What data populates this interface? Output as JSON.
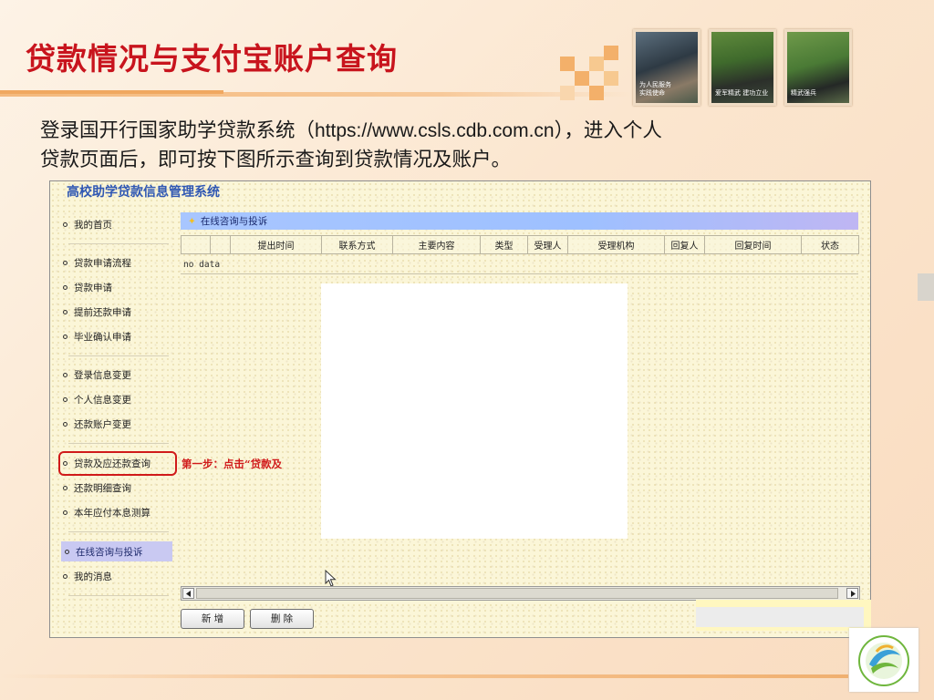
{
  "slide": {
    "title": "贷款情况与支付宝账户查询",
    "body_line1_before": "登录国开行国家助学贷款系统（",
    "body_url": "https://www.csls.cdb.com.cn",
    "body_line1_after": "），进入个人",
    "body_line2": "贷款页面后，即可按下图所示查询到贷款情况及账户。",
    "photo_captions": [
      "为人民服务\n实践使命",
      "爱军精武  建功立业",
      "精武强兵"
    ]
  },
  "screenshot": {
    "system_title": "高校助学贷款信息管理系统",
    "menu": [
      {
        "label": "我的首页"
      },
      {
        "label": "贷款申请流程"
      },
      {
        "label": "贷款申请"
      },
      {
        "label": "提前还款申请"
      },
      {
        "label": "毕业确认申请"
      },
      {
        "label": "登录信息变更"
      },
      {
        "label": "个人信息变更"
      },
      {
        "label": "还款账户变更"
      },
      {
        "label": "贷款及应还款查询"
      },
      {
        "label": "还款明细查询"
      },
      {
        "label": "本年应付本息测算"
      },
      {
        "label": "在线咨询与投诉"
      },
      {
        "label": "我的消息"
      }
    ],
    "active_menu": "在线咨询与投诉",
    "step_annotation": "第一步：点击“贷款及",
    "panel_title": "在线咨询与投诉",
    "columns": [
      "",
      "",
      "提出时间",
      "联系方式",
      "主要内容",
      "类型",
      "受理人",
      "受理机构",
      "回复人",
      "回复时间",
      "状态"
    ],
    "empty_text": "no data",
    "buttons": {
      "add": "新 增",
      "delete": "删 除"
    },
    "colors": {
      "title_red": "#c8141d",
      "highlight_red": "#d01a1a",
      "link_blue": "#2f57b3",
      "panel_blue": "#a8c6ff",
      "active_menu_bg": "#c9c9f2"
    }
  }
}
